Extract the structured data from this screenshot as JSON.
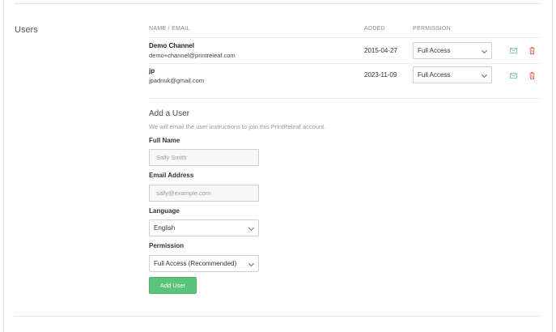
{
  "section": {
    "title": "Users"
  },
  "table": {
    "headers": {
      "name_email": "NAME / EMAIL",
      "added": "ADDED",
      "permission": "PERMISSION"
    },
    "rows": [
      {
        "name": "Demo Channel",
        "email": "demo+channel@printreleaf.com",
        "added": "2015-04-27",
        "permission": "Full Access"
      },
      {
        "name": "jp",
        "email": "jpadnuk@gmail.com",
        "added": "2023-11-09",
        "permission": "Full Access"
      }
    ]
  },
  "add_user": {
    "title": "Add a User",
    "subtitle": "We will email the user instructions to join this PrintReleaf account.",
    "full_name_label": "Full Name",
    "full_name_placeholder": "Sally Smith",
    "email_label": "Email Address",
    "email_placeholder": "sally@example.com",
    "language_label": "Language",
    "language_value": "English",
    "permission_label": "Permission",
    "permission_value": "Full Access (Recommended)",
    "submit_label": "Add User"
  },
  "colors": {
    "accent_green": "#5cc47a",
    "delete_red": "#e0675a",
    "email_green": "#7fd39a"
  },
  "icons": {
    "resend": "envelope-icon",
    "delete": "trash-icon"
  }
}
